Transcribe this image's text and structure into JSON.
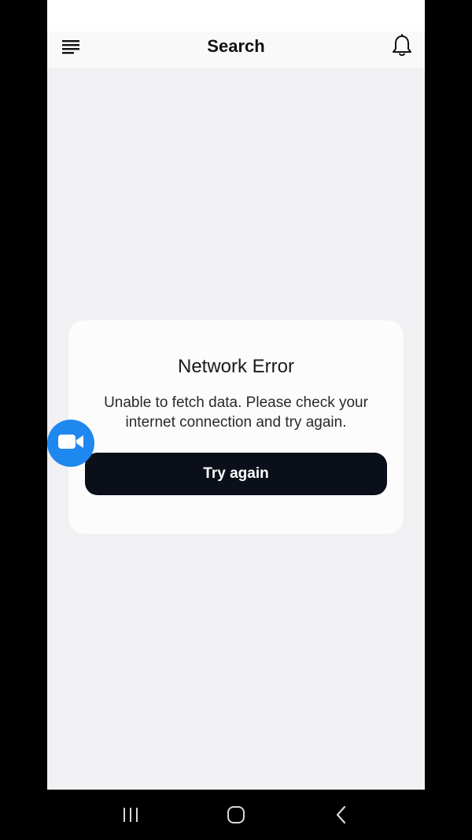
{
  "header": {
    "title": "Search",
    "menu_icon": "menu-icon",
    "notification_icon": "bell-icon"
  },
  "error_dialog": {
    "title": "Network Error",
    "message": "Unable to fetch data. Please check your internet connection and try again.",
    "button_label": "Try again"
  },
  "floating_button": {
    "icon": "video-camera-icon",
    "color": "#1f87f0"
  },
  "navigation_bar": {
    "recents_icon": "recent-apps-icon",
    "home_icon": "home-icon",
    "back_icon": "back-icon"
  },
  "colors": {
    "background": "#f1f0f2",
    "card": "#fdfcfd",
    "button": "#0b0f19",
    "accent": "#1f87f0"
  }
}
